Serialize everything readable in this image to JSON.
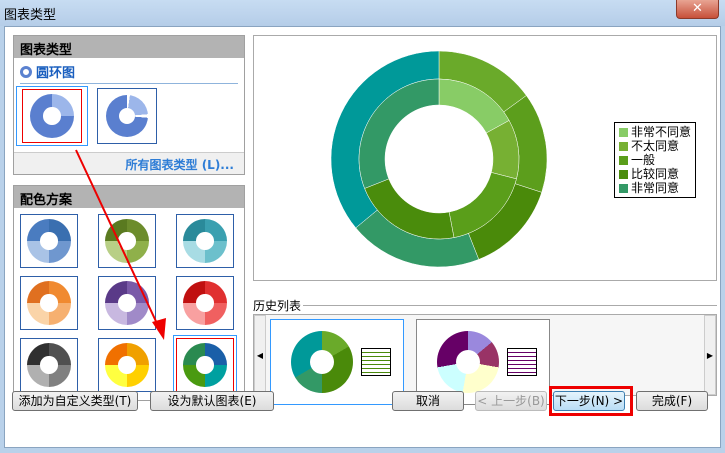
{
  "window": {
    "title": "图表类型",
    "close": "✕"
  },
  "chart_type_panel": {
    "header": "图表类型",
    "category": "圆环图",
    "all_types_link": "所有图表类型 (L)..."
  },
  "color_scheme_panel": {
    "header": "配色方案",
    "schemes": [
      [
        "#3a6fb0",
        "#6f97cf",
        "#a9c3e6",
        "#4a7cc0"
      ],
      [
        "#6c8c2c",
        "#8fb04a",
        "#b8cf86",
        "#5a7a20"
      ],
      [
        "#3aa0b0",
        "#6cc0cc",
        "#a8dce4",
        "#2a8a9a"
      ],
      [
        "#f08a30",
        "#f6b070",
        "#fad4a8",
        "#e07020"
      ],
      [
        "#7a5aa8",
        "#a08ac8",
        "#c8b8e0",
        "#5a3a88"
      ],
      [
        "#e03030",
        "#f06060",
        "#f8a0a0",
        "#c01010"
      ],
      [
        "#505050",
        "#808080",
        "#b0b0b0",
        "#303030"
      ],
      [
        "#f0a000",
        "#ffd000",
        "#ffff40",
        "#f07000"
      ],
      [
        "#1a5fa8",
        "#00a0a0",
        "#4a9a10",
        "#2a8a50"
      ]
    ]
  },
  "preview": {
    "legend": [
      "非常不同意",
      "不太同意",
      "一般",
      "比较同意",
      "非常同意"
    ],
    "colors": [
      "#88cc66",
      "#77b033",
      "#5a9e1a",
      "#4a8c0c",
      "#339966"
    ],
    "outer_ring_values": [
      15,
      15,
      14,
      20,
      36
    ],
    "inner_ring_values": [
      17,
      12,
      18,
      22,
      31
    ],
    "outer_colors": [
      "#6aaa2a",
      "#5c9e1c",
      "#4a8a0a",
      "#339966",
      "#009999"
    ]
  },
  "history": {
    "label": "历史列表",
    "left_arrow": "◀",
    "right_arrow": "▶"
  },
  "buttons": {
    "add_custom": "添加为自定义类型(T)",
    "set_default": "设为默认图表(E)",
    "cancel": "取消",
    "prev": "< 上一步(B)",
    "next": "下一步(N) >",
    "finish": "完成(F)"
  }
}
